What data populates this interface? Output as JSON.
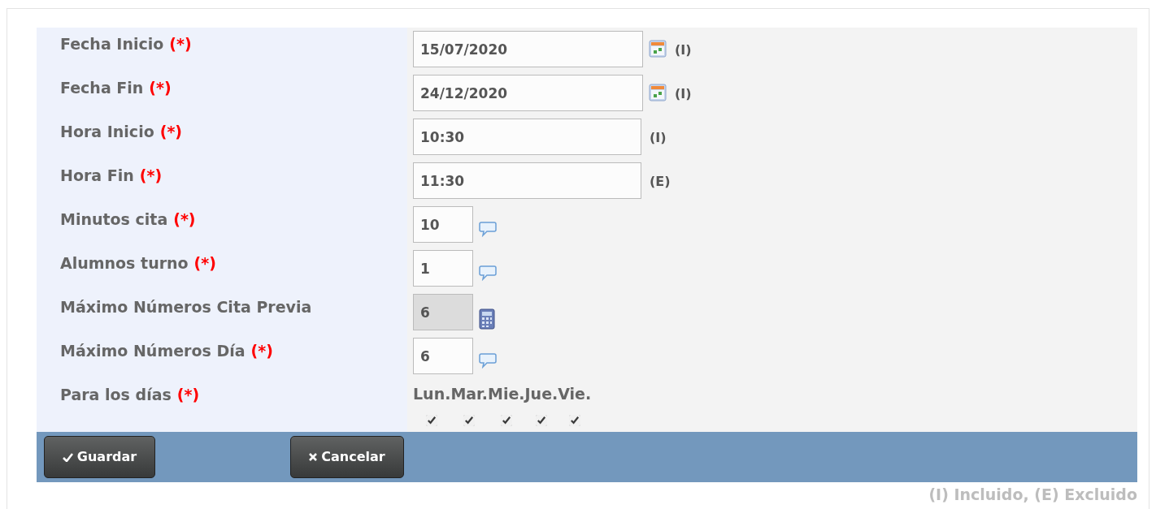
{
  "fields": [
    {
      "label": "Fecha Inicio",
      "required": "(*)",
      "kind": "date",
      "value": "15/07/2020",
      "disabled": false,
      "note": "(I)"
    },
    {
      "label": "Fecha Fin",
      "required": "(*)",
      "kind": "date",
      "value": "24/12/2020",
      "disabled": false,
      "note": "(I)"
    },
    {
      "label": "Hora Inicio",
      "required": "(*)",
      "kind": "time",
      "value": "10:30",
      "disabled": false,
      "note": "(I)"
    },
    {
      "label": "Hora Fin",
      "required": "(*)",
      "kind": "time",
      "value": "11:30",
      "disabled": false,
      "note": "(E)"
    },
    {
      "label": "Minutos cita",
      "required": "(*)",
      "kind": "number",
      "value": "10",
      "disabled": false
    },
    {
      "label": "Alumnos turno",
      "required": "(*)",
      "kind": "number",
      "value": "1",
      "disabled": false
    },
    {
      "label": "Máximo Números Cita Previa",
      "kind": "number",
      "value": "6",
      "disabled": true
    },
    {
      "label": "Máximo Números Día",
      "required": "(*)",
      "kind": "number",
      "value": "6",
      "disabled": false
    }
  ],
  "days": {
    "label": "Para los días",
    "required": "(*)",
    "items": [
      {
        "label": "Lun.",
        "checked": true
      },
      {
        "label": "Mar.",
        "checked": true
      },
      {
        "label": "Mie.",
        "checked": true
      },
      {
        "label": "Jue.",
        "checked": true
      },
      {
        "label": "Vie.",
        "checked": true
      }
    ]
  },
  "buttons": [
    {
      "kind": "save",
      "label": "Guardar"
    },
    {
      "kind": "cancel",
      "label": "Cancelar"
    }
  ],
  "legend": "(I) Incluido, (E) Excluido"
}
